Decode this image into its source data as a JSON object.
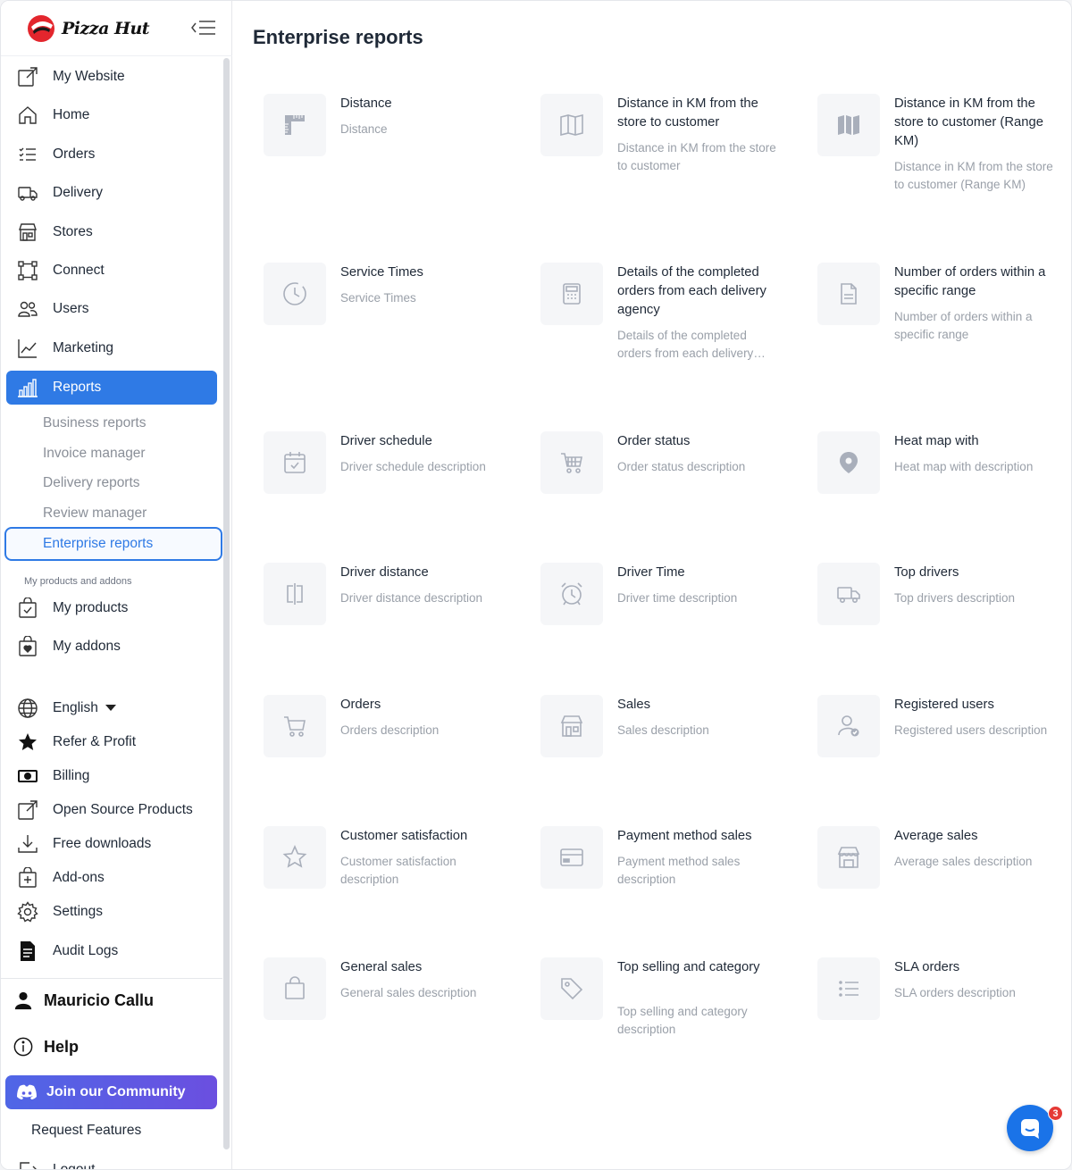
{
  "brand": {
    "logo_text": "Pizza Hut"
  },
  "sidebar": {
    "items": [
      {
        "label": "My Website",
        "icon": "external-link-icon"
      },
      {
        "label": "Home",
        "icon": "home-icon"
      },
      {
        "label": "Orders",
        "icon": "list-icon"
      },
      {
        "label": "Delivery",
        "icon": "truck-icon"
      },
      {
        "label": "Stores",
        "icon": "store-icon"
      },
      {
        "label": "Connect",
        "icon": "connect-icon"
      },
      {
        "label": "Users",
        "icon": "users-icon"
      },
      {
        "label": "Marketing",
        "icon": "chart-line-icon"
      },
      {
        "label": "Reports",
        "icon": "bar-chart-icon"
      }
    ],
    "sub_items": [
      "Business reports",
      "Invoice manager",
      "Delivery reports",
      "Review manager",
      "Enterprise reports"
    ],
    "section_label": "My products and addons",
    "product_items": [
      {
        "label": "My products",
        "icon": "bag-check-icon"
      },
      {
        "label": "My addons",
        "icon": "bag-heart-icon"
      }
    ],
    "language": "English",
    "footer_items": [
      {
        "label": "Refer & Profit",
        "icon": "star-icon"
      },
      {
        "label": "Billing",
        "icon": "money-icon"
      },
      {
        "label": "Open Source Products",
        "icon": "external-link-icon"
      },
      {
        "label": "Free downloads",
        "icon": "download-icon"
      },
      {
        "label": "Add-ons",
        "icon": "bag-plus-icon"
      },
      {
        "label": "Settings",
        "icon": "gear-icon"
      },
      {
        "label": "Audit Logs",
        "icon": "document-icon"
      }
    ],
    "user_name": "Mauricio Callu",
    "help_label": "Help",
    "community_label": "Join our Community",
    "request_features": "Request Features",
    "logout": "Logout"
  },
  "main": {
    "title": "Enterprise reports",
    "cards": [
      {
        "title": "Distance",
        "desc": "Distance",
        "icon": "ruler-icon"
      },
      {
        "title": "Distance in KM from the store to customer",
        "desc": "Distance in KM from the store to customer",
        "icon": "map-icon"
      },
      {
        "title": "Distance in KM from the store to customer (Range KM)",
        "desc": "Distance in KM from the store to customer (Range KM)",
        "icon": "map-filled-icon"
      },
      {
        "title": "Service Times",
        "desc": "Service Times",
        "icon": "clock-icon"
      },
      {
        "title": "Details of the completed orders from each delivery agency",
        "desc": "Details of the completed orders from each delivery agency",
        "icon": "calculator-icon"
      },
      {
        "title": "Number of orders within a specific range",
        "desc": "Number of orders within a specific range",
        "icon": "document-icon"
      },
      {
        "title": "Driver schedule",
        "desc": "Driver schedule description",
        "icon": "calendar-check-icon"
      },
      {
        "title": "Order status",
        "desc": "Order status description",
        "icon": "cart-icon"
      },
      {
        "title": "Heat map with",
        "desc": "Heat map with description",
        "icon": "map-pin-icon"
      },
      {
        "title": "Driver distance",
        "desc": "Driver distance description",
        "icon": "split-icon"
      },
      {
        "title": "Driver Time",
        "desc": "Driver time description",
        "icon": "alarm-icon"
      },
      {
        "title": "Top drivers",
        "desc": "Top drivers description",
        "icon": "truck-icon"
      },
      {
        "title": "Orders",
        "desc": "Orders description",
        "icon": "cart-icon"
      },
      {
        "title": "Sales",
        "desc": "Sales description",
        "icon": "store-icon"
      },
      {
        "title": "Registered users",
        "desc": "Registered users description",
        "icon": "user-check-icon"
      },
      {
        "title": "Customer satisfaction",
        "desc": "Customer satisfaction description",
        "icon": "star-outline-icon"
      },
      {
        "title": "Payment method sales",
        "desc": "Payment method sales description",
        "icon": "credit-card-icon"
      },
      {
        "title": "Average sales",
        "desc": "Average sales description",
        "icon": "store-icon"
      },
      {
        "title": "General sales",
        "desc": "General sales description",
        "icon": "shopping-bag-icon"
      },
      {
        "title": "Top selling and category",
        "desc": "Top selling and category description",
        "icon": "tag-icon"
      },
      {
        "title": "SLA orders",
        "desc": "SLA orders description",
        "icon": "list-icon"
      }
    ]
  },
  "chat": {
    "badge_count": "3"
  },
  "colors": {
    "accent": "#2f7ae5",
    "community": "#5b5ce6",
    "muted_text": "#9aa0a9",
    "tile_bg": "#f5f6f8"
  }
}
